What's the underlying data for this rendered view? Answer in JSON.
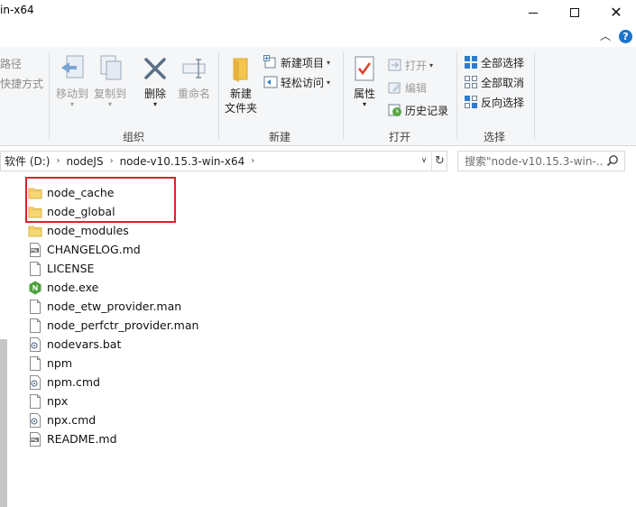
{
  "window": {
    "title": "in-x64"
  },
  "titlebar": {
    "minimize_icon": "minimize-icon",
    "maximize_icon": "maximize-icon",
    "close_icon": "close-icon"
  },
  "ribbon": {
    "left_cut": {
      "copy_path": "路径",
      "paste_shortcut": "快捷方式"
    },
    "organize": {
      "label": "组织",
      "move_to": "移动到",
      "copy_to": "复制到",
      "delete": "删除",
      "rename": "重命名"
    },
    "new": {
      "label": "新建",
      "new_folder": "新建\n文件夹",
      "new_folder_line1": "新建",
      "new_folder_line2": "文件夹",
      "new_item": "新建项目",
      "easy_access": "轻松访问"
    },
    "open": {
      "label": "打开",
      "properties": "属性",
      "open": "打开",
      "edit": "编辑",
      "history": "历史记录"
    },
    "select": {
      "label": "选择",
      "select_all": "全部选择",
      "select_none": "全部取消",
      "invert": "反向选择"
    }
  },
  "address": {
    "crumbs": [
      "软件 (D:)",
      "nodeJS",
      "node-v10.15.3-win-x64"
    ],
    "search_placeholder": "搜索\"node-v10.15.3-win-..."
  },
  "files": [
    {
      "name": "node_cache",
      "icon": "folder-icon"
    },
    {
      "name": "node_global",
      "icon": "folder-icon"
    },
    {
      "name": "node_modules",
      "icon": "folder-icon"
    },
    {
      "name": "CHANGELOG.md",
      "icon": "md-file-icon"
    },
    {
      "name": "LICENSE",
      "icon": "file-icon"
    },
    {
      "name": "node.exe",
      "icon": "node-exe-icon"
    },
    {
      "name": "node_etw_provider.man",
      "icon": "file-icon"
    },
    {
      "name": "node_perfctr_provider.man",
      "icon": "file-icon"
    },
    {
      "name": "nodevars.bat",
      "icon": "bat-file-icon"
    },
    {
      "name": "npm",
      "icon": "file-icon"
    },
    {
      "name": "npm.cmd",
      "icon": "bat-file-icon"
    },
    {
      "name": "npx",
      "icon": "file-icon"
    },
    {
      "name": "npx.cmd",
      "icon": "bat-file-icon"
    },
    {
      "name": "README.md",
      "icon": "md-file-icon"
    }
  ],
  "colors": {
    "highlight_border": "#e0202a",
    "folder": "#f6d776",
    "help": "#1a73c9"
  }
}
